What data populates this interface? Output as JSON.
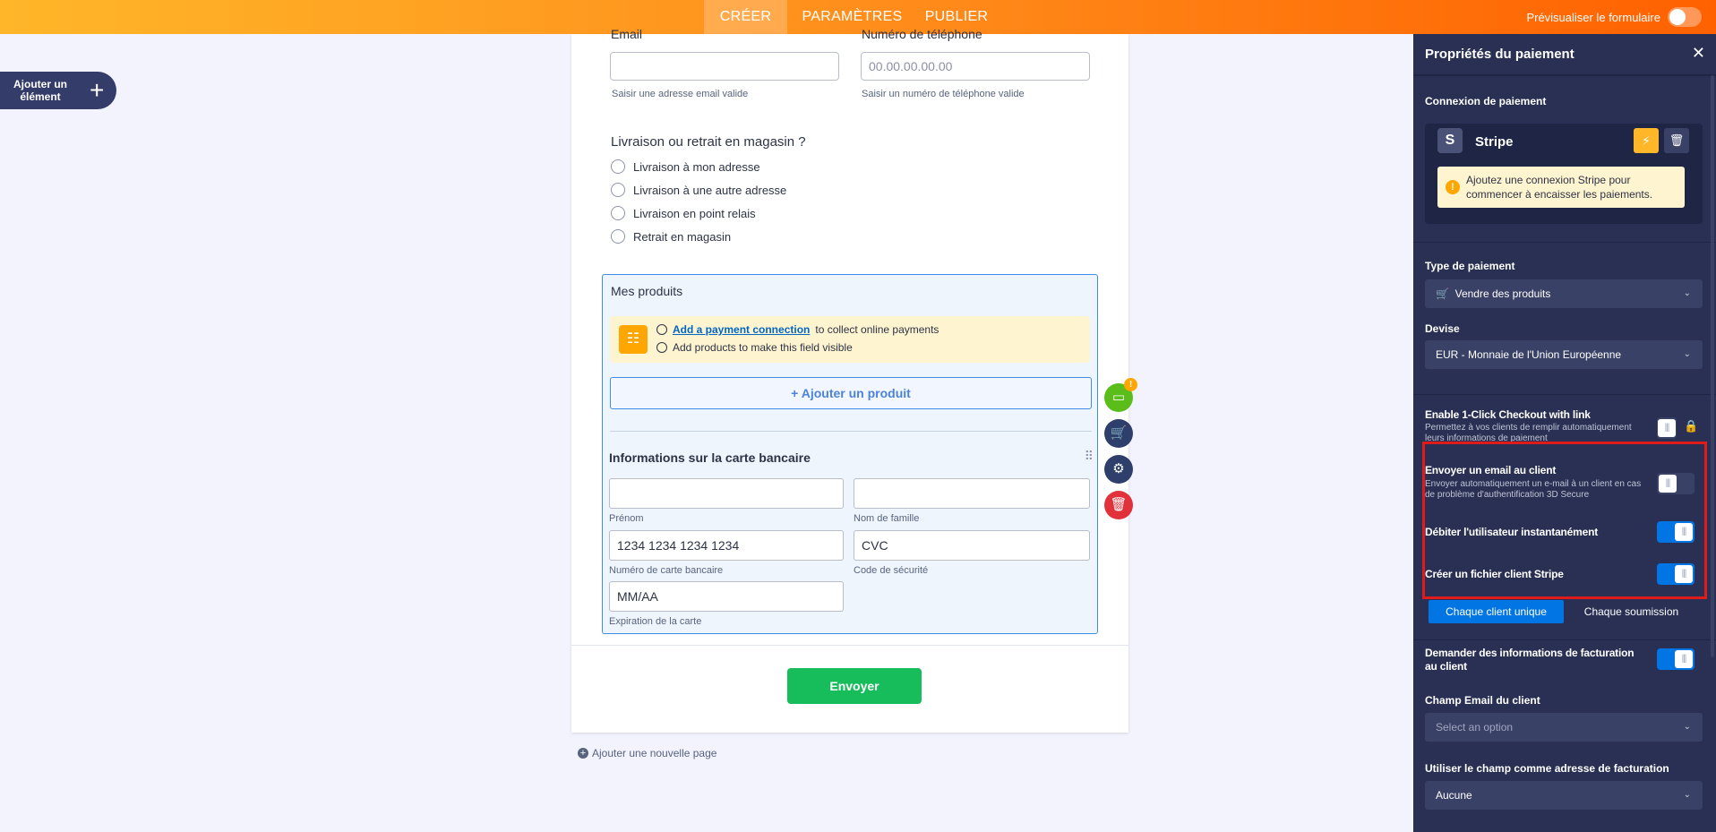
{
  "topbar": {
    "tabs": [
      "CRÉER",
      "PARAMÈTRES",
      "PUBLIER"
    ],
    "preview_label": "Prévisualiser le formulaire"
  },
  "add_element": {
    "label": "Ajouter un élément",
    "plus": "+"
  },
  "form": {
    "email": {
      "label": "Email",
      "value": "",
      "help": "Saisir une adresse email valide"
    },
    "phone": {
      "label": "Numéro de téléphone",
      "placeholder": "00.00.00.00.00",
      "help": "Saisir un numéro de téléphone valide"
    },
    "delivery": {
      "question": "Livraison ou retrait en magasin ?",
      "options": [
        "Livraison à mon adresse",
        "Livraison à une autre adresse",
        "Livraison en point relais",
        "Retrait en magasin"
      ]
    },
    "products": {
      "title": "Mes produits",
      "notice_link": "Add a payment connection",
      "notice_rest": "to collect online payments",
      "notice_line2": "Add products to make this field visible",
      "add_button": "+ Ajouter un produit"
    },
    "card": {
      "title": "Informations sur la carte bancaire",
      "first_name_label": "Prénom",
      "last_name_label": "Nom de famille",
      "number_value": "1234 1234 1234 1234",
      "number_label": "Numéro de carte bancaire",
      "cvc_value": "CVC",
      "cvc_label": "Code de sécurité",
      "expiry_value": "MM/AA",
      "expiry_label": "Expiration de la carte"
    },
    "submit_label": "Envoyer",
    "add_page_label": "Ajouter une nouvelle page",
    "tool_badge": "!"
  },
  "panel": {
    "title": "Propriétés du paiement",
    "close": "✕",
    "connection_title": "Connexion de paiement",
    "stripe_letter": "S",
    "stripe_name": "Stripe",
    "warning": "Ajoutez une connexion Stripe pour commencer à encaisser les paiements.",
    "payment_type_title": "Type de paiement",
    "payment_type_value": "Vendre des produits",
    "currency_title": "Devise",
    "currency_value": "EUR - Monnaie de l'Union Européenne",
    "one_click_title": "Enable 1-Click Checkout with link",
    "one_click_desc": "Permettez à vos clients de remplir automatiquement leurs informations de paiement",
    "send_email_title": "Envoyer un email au client",
    "send_email_desc": "Envoyer automatiquement un e-mail à un client en cas de problème d'authentification 3D Secure",
    "debit_title": "Débiter l'utilisateur instantanément",
    "customer_title": "Créer un fichier client Stripe",
    "seg_options": [
      "Chaque client unique",
      "Chaque soumission"
    ],
    "billing_title": "Demander des informations de facturation au client",
    "email_field_title": "Champ Email du client",
    "email_field_placeholder": "Select an option",
    "billing_field_title": "Utiliser le champ comme adresse de facturation",
    "billing_field_value": "Aucune",
    "toggles": {
      "one_click": false,
      "send_email": false,
      "debit": true,
      "customer_file": true,
      "billing": true
    }
  },
  "colors": {
    "accent_orange": "#ff8a1a",
    "panel_bg": "#293053",
    "toggle_on": "#0075e3",
    "submit_green": "#18bd5b",
    "highlight_red": "#e01b1b"
  }
}
